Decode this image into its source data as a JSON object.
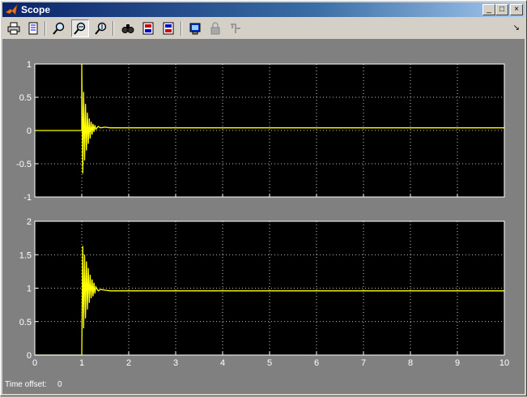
{
  "window": {
    "title": "Scope"
  },
  "titlebar_buttons": {
    "minimize": "_",
    "maximize": "□",
    "close": "×"
  },
  "toolbar": {
    "tools": [
      "print-icon",
      "parameters-icon",
      "zoom-icon",
      "zoom-x-icon",
      "zoom-y-icon",
      "autoscale-icon",
      "save-axes-icon",
      "restore-axes-icon",
      "floating-scope-icon",
      "lock-axes-icon",
      "signal-selection-icon"
    ]
  },
  "time_offset": {
    "label": "Time offset:",
    "value": "0"
  },
  "colors": {
    "plot_bg": "#000000",
    "frame_bg": "#808080",
    "trace": "#ffff00",
    "axis_text": "#ffffff"
  },
  "chart_data": [
    {
      "type": "line",
      "title": "",
      "xlabel": "",
      "ylabel": "",
      "xlim": [
        0,
        10
      ],
      "ylim": [
        -1,
        1
      ],
      "xticks": [
        0,
        1,
        2,
        3,
        4,
        5,
        6,
        7,
        8,
        9,
        10
      ],
      "yticks": [
        -1,
        -0.5,
        0,
        0.5,
        1
      ],
      "xtick_labels": [],
      "ytick_labels": [
        "1",
        "0.5",
        "0",
        "-0.5",
        "-1"
      ],
      "grid": true,
      "series": [
        {
          "x": [
            0,
            1,
            1,
            1.02,
            1.04,
            1.06,
            1.08,
            1.1,
            1.12,
            1.14,
            1.16,
            1.18,
            1.2,
            1.22,
            1.24,
            1.26,
            1.28,
            1.3,
            1.35,
            1.4,
            1.5,
            1.6,
            2,
            10
          ],
          "y": [
            0,
            0,
            1,
            -0.65,
            0.58,
            -0.45,
            0.4,
            -0.3,
            0.27,
            -0.2,
            0.18,
            -0.12,
            0.13,
            -0.06,
            0.1,
            -0.02,
            0.08,
            0.02,
            0.06,
            0.04,
            0.05,
            0.04,
            0.04,
            0.04
          ]
        }
      ]
    },
    {
      "type": "line",
      "title": "",
      "xlabel": "",
      "ylabel": "",
      "xlim": [
        0,
        10
      ],
      "ylim": [
        0,
        2
      ],
      "xticks": [
        0,
        1,
        2,
        3,
        4,
        5,
        6,
        7,
        8,
        9,
        10
      ],
      "yticks": [
        0,
        0.5,
        1,
        1.5,
        2
      ],
      "xtick_labels": [
        "0",
        "1",
        "2",
        "3",
        "4",
        "5",
        "6",
        "7",
        "8",
        "9",
        "10"
      ],
      "ytick_labels": [
        "2",
        "1.5",
        "1",
        "0.5",
        "0"
      ],
      "grid": true,
      "series": [
        {
          "x": [
            0,
            1,
            1.02,
            1.04,
            1.06,
            1.08,
            1.1,
            1.12,
            1.14,
            1.16,
            1.18,
            1.2,
            1.22,
            1.24,
            1.26,
            1.28,
            1.3,
            1.35,
            1.4,
            1.5,
            1.6,
            2,
            10
          ],
          "y": [
            0,
            0,
            1.63,
            0.4,
            1.5,
            0.55,
            1.4,
            0.68,
            1.3,
            0.78,
            1.2,
            0.85,
            1.13,
            0.88,
            1.08,
            0.92,
            1.02,
            0.96,
            0.98,
            0.97,
            0.96,
            0.96,
            0.96
          ]
        }
      ]
    }
  ]
}
